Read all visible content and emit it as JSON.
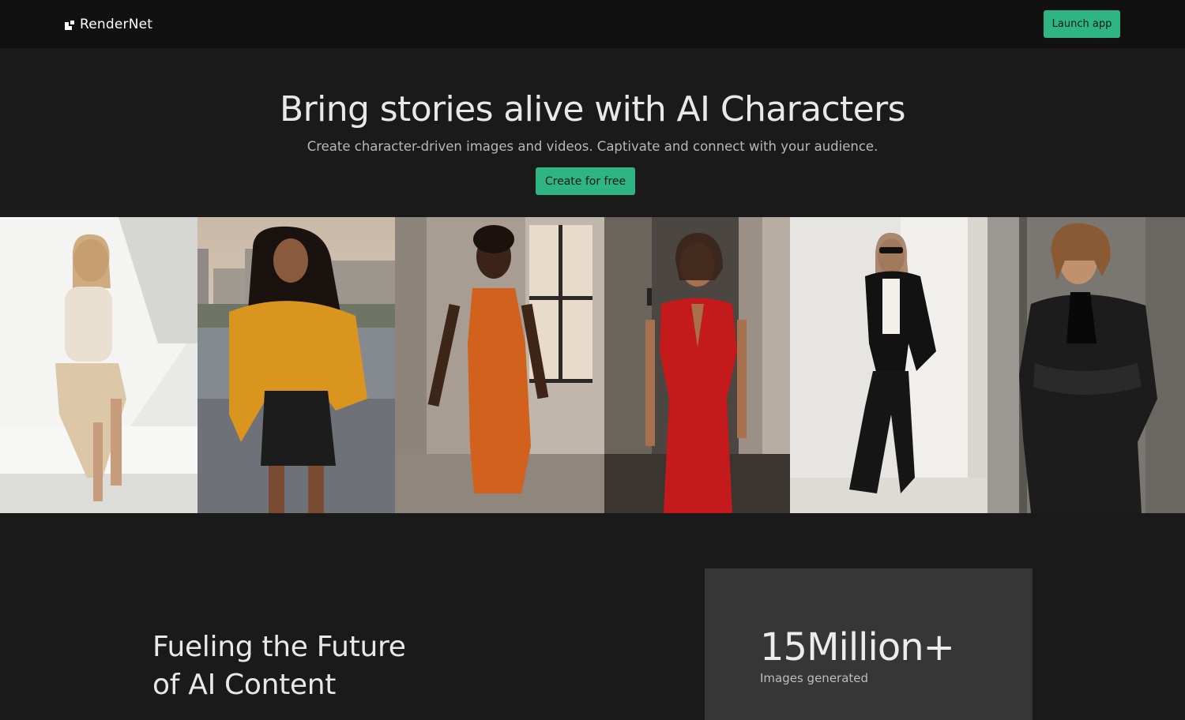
{
  "header": {
    "brand": "RenderNet",
    "launch_label": "Launch app"
  },
  "hero": {
    "title": "Bring stories alive with AI Characters",
    "subtitle": "Create character-driven images and videos. Captivate and connect with your audience.",
    "cta_label": "Create for free"
  },
  "gallery": {
    "images": [
      {
        "subject": "woman-cream-knit-on-white-bench"
      },
      {
        "subject": "woman-mustard-sweater-city-rooftop"
      },
      {
        "subject": "woman-orange-knit-dress-window"
      },
      {
        "subject": "woman-red-dress-concrete-hall"
      },
      {
        "subject": "woman-black-suit-white-wall"
      },
      {
        "subject": "woman-black-leather-jacket-concrete"
      }
    ]
  },
  "section": {
    "heading_line1": "Fueling the Future",
    "heading_line2": "of AI Content"
  },
  "stats": {
    "value": "15Million+",
    "label": "Images generated"
  },
  "colors": {
    "accent": "#2fb584",
    "background": "#1a1a1a",
    "topbar": "#111111",
    "card": "#363636"
  }
}
